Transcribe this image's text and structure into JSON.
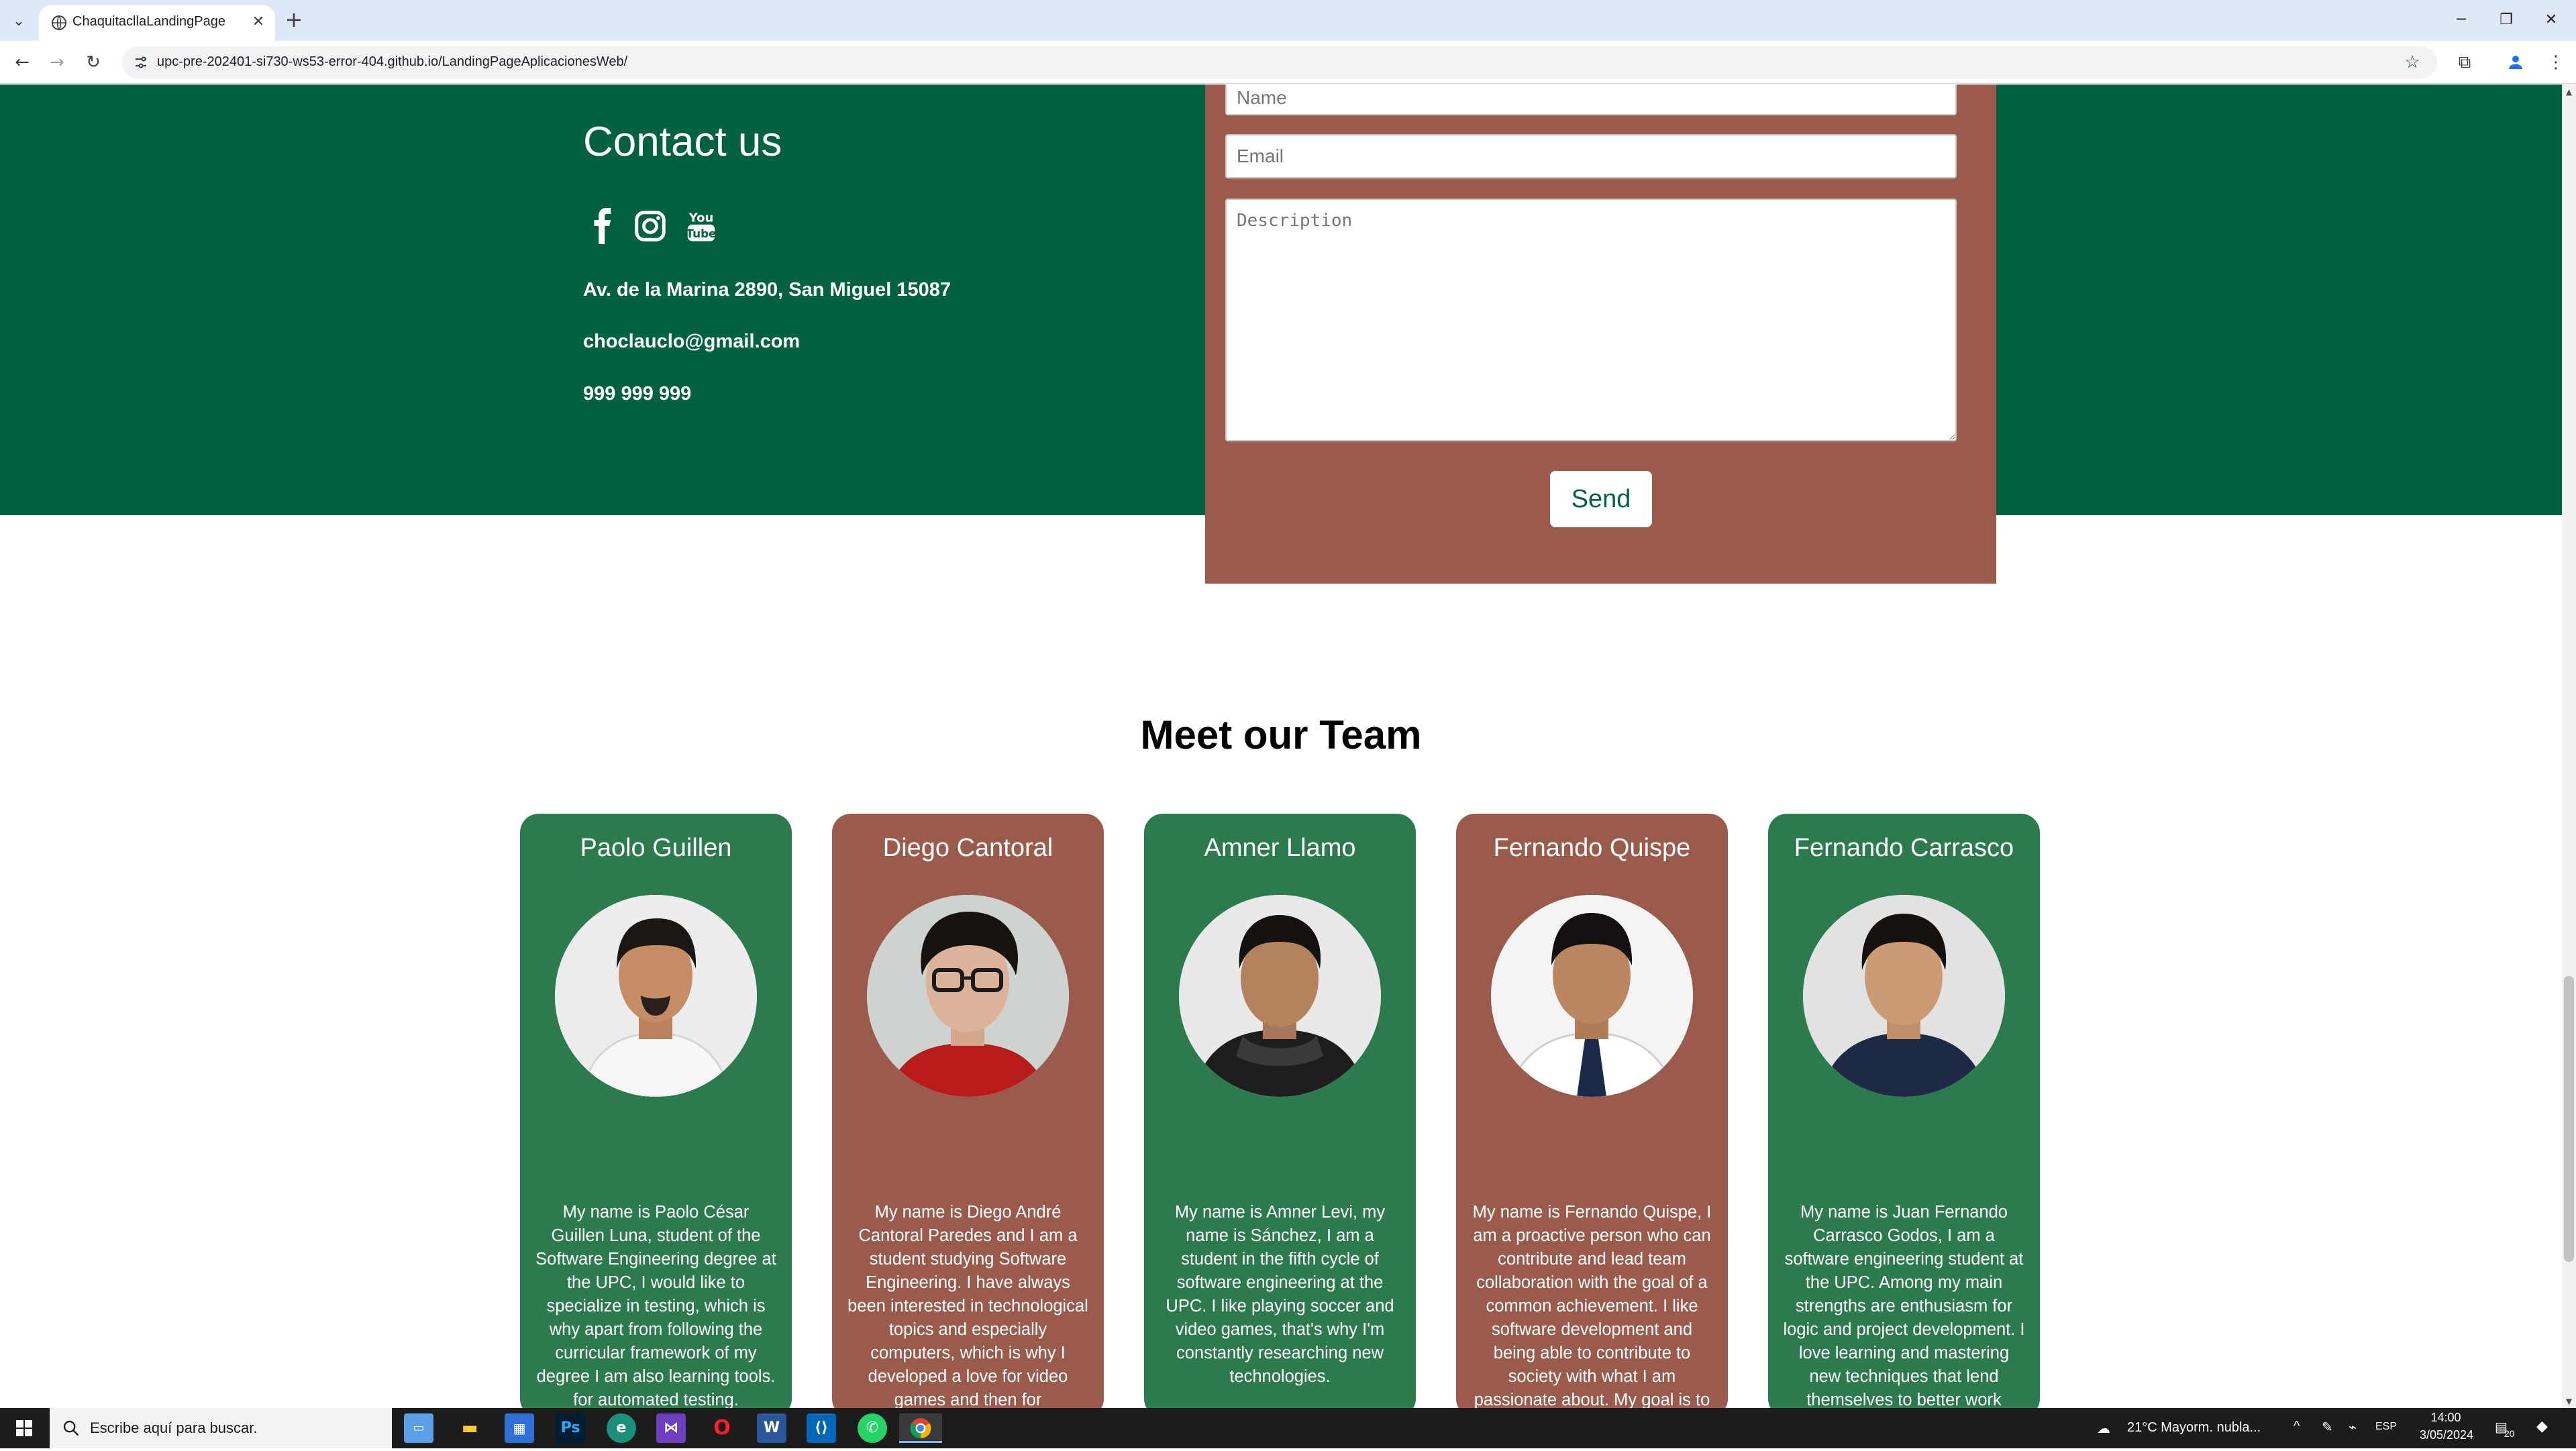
{
  "browser": {
    "tab_title": "ChaquitacllaLandingPage",
    "url": "upc-pre-202401-si730-ws53-error-404.github.io/LandingPageAplicacionesWeb/"
  },
  "contact": {
    "title": "Contact us",
    "address": "Av. de la Marina 2890, San Miguel 15087",
    "email": "choclauclo@gmail.com",
    "phone": "999 999 999",
    "social": [
      "facebook-icon",
      "instagram-icon",
      "youtube-icon"
    ]
  },
  "form": {
    "name_placeholder": "Name",
    "email_placeholder": "Email",
    "description_placeholder": "Description",
    "send_label": "Send"
  },
  "team": {
    "title": "Meet our Team",
    "members": [
      {
        "name": "Paolo Guillen",
        "bio": "My name is Paolo César Guillen Luna, student of the Software Engineering degree at the UPC, I would like to specialize in testing, which is why apart from following the curricular framework of my degree I am also learning tools. for automated testing."
      },
      {
        "name": "Diego Cantoral",
        "bio": "My name is Diego André Cantoral Paredes and I am a student studying Software Engineering. I have always been interested in technological topics and especially computers, which is why I developed a love for video games and then for programming."
      },
      {
        "name": "Amner Llamo",
        "bio": "My name is Amner Levi, my name is Sánchez, I am a student in the fifth cycle of software engineering at the UPC. I like playing soccer and video games, that's why I'm constantly researching new technologies."
      },
      {
        "name": "Fernando Quispe",
        "bio": "My name is Fernando Quispe, I am a proactive person who can contribute and lead team collaboration with the goal of a common achievement. I like software development and being able to contribute to society with what I am passionate about. My goal is to acquire knowledge in a clear way to be able to apply it in different projects, such as the"
      },
      {
        "name": "Fernando Carrasco",
        "bio": "My name is Juan Fernando Carrasco Godos, I am a software engineering student at the UPC. Among my main strengths are enthusiasm for logic and project development. I love learning and mastering new techniques that lend themselves to better work organization and direction towards the final goal."
      }
    ]
  },
  "taskbar": {
    "search_placeholder": "Escribe aquí para buscar.",
    "weather": "21°C  Mayorm. nubla...",
    "language": "ESP",
    "time": "14:00",
    "date": "3/05/2024",
    "notification_count": "20"
  },
  "colors": {
    "contact_bg": "#02613f",
    "form_bg": "#9a5b4c",
    "card_green": "#2e7a4f",
    "card_brown": "#9a5b4c"
  }
}
